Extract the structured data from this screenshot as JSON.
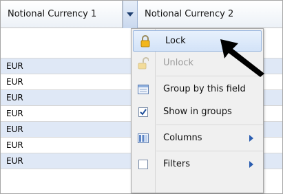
{
  "header": {
    "col1": "Notional Currency 1",
    "col2": "Notional Currency 2"
  },
  "rows": [
    "",
    "EUR",
    "EUR",
    "EUR",
    "EUR",
    "EUR",
    "EUR",
    "EUR"
  ],
  "menu": {
    "lock": "Lock",
    "unlock": "Unlock",
    "group": "Group by this field",
    "show_groups": "Show in groups",
    "columns": "Columns",
    "filters": "Filters"
  },
  "icons": {
    "lock": "lock-icon",
    "unlock": "unlock-icon",
    "group": "group-icon",
    "checkbox": "checkbox-icon",
    "columns": "columns-icon",
    "filters": "filter-checkbox-icon"
  },
  "colors": {
    "row_alt": "#dfe8f6",
    "menu_highlight": "#d3e3f8",
    "submenu_arrow": "#2a5db0"
  }
}
